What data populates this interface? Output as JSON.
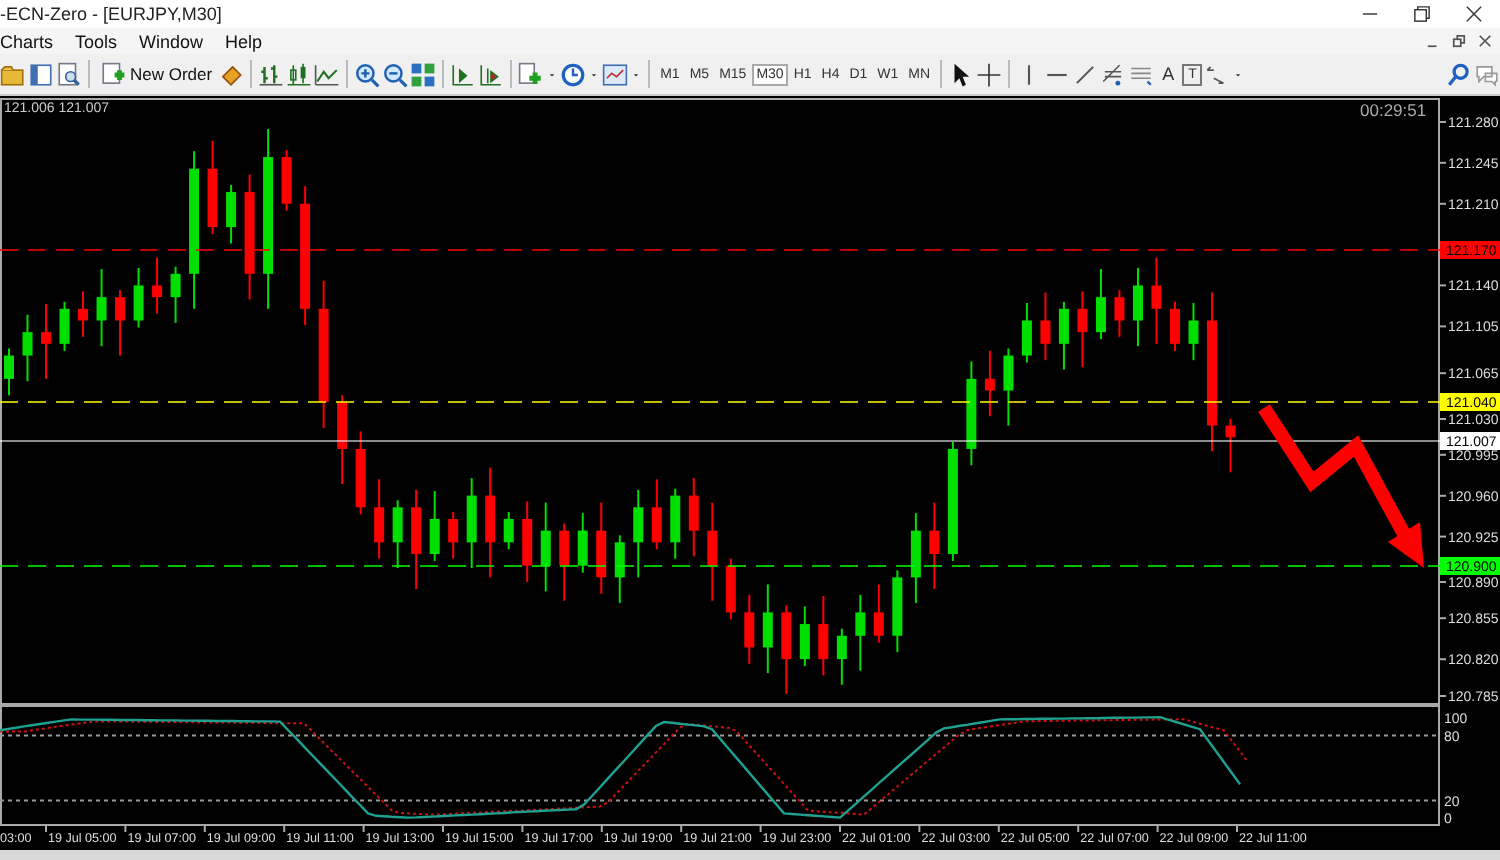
{
  "window": {
    "title": "-ECN-Zero - [EURJPY,M30]"
  },
  "menu": [
    {
      "label": "Charts"
    },
    {
      "label": "Tools"
    },
    {
      "label": "Window"
    },
    {
      "label": "Help"
    }
  ],
  "toolbar": {
    "new_order": "New Order",
    "text_tool": "A",
    "label_tool": "T",
    "periods": [
      {
        "label": "M1",
        "selected": false
      },
      {
        "label": "M5",
        "selected": false
      },
      {
        "label": "M15",
        "selected": false
      },
      {
        "label": "M30",
        "selected": true
      },
      {
        "label": "H1",
        "selected": false
      },
      {
        "label": "H4",
        "selected": false
      },
      {
        "label": "D1",
        "selected": false
      },
      {
        "label": "W1",
        "selected": false
      },
      {
        "label": "MN",
        "selected": false
      }
    ]
  },
  "chart": {
    "bid_ask": "121.006 121.007",
    "timer": "00:29:51",
    "price_labels": [
      "121.280",
      "121.245",
      "121.210",
      "121.140",
      "121.105",
      "121.065",
      "121.030",
      "120.995",
      "120.960",
      "120.925",
      "120.890",
      "120.855",
      "120.820",
      "120.785"
    ],
    "level_lines": [
      {
        "label": "121.170",
        "color": "#ff0000"
      },
      {
        "label": "121.040",
        "color": "#ffff00"
      },
      {
        "label": "121.007",
        "color": "#ffffff"
      },
      {
        "label": "120.900",
        "color": "#00ff00"
      }
    ],
    "oscillator_labels": [
      "100",
      "80",
      "20",
      "0"
    ],
    "time_labels": [
      "03:00",
      "19 Jul 05:00",
      "19 Jul 07:00",
      "19 Jul 09:00",
      "19 Jul 11:00",
      "19 Jul 13:00",
      "19 Jul 15:00",
      "19 Jul 17:00",
      "19 Jul 19:00",
      "19 Jul 21:00",
      "19 Jul 23:00",
      "22 Jul 01:00",
      "22 Jul 03:00",
      "22 Jul 05:00",
      "22 Jul 07:00",
      "22 Jul 09:00",
      "22 Jul 11:00"
    ]
  }
}
